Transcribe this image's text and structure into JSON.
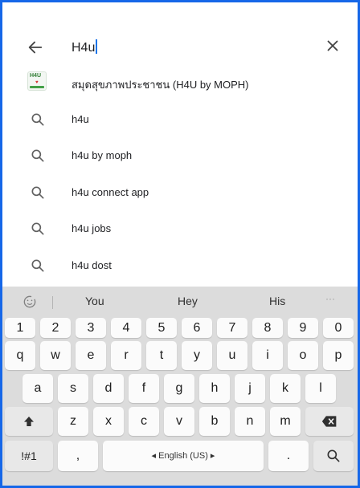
{
  "search": {
    "query": "H4u",
    "back_icon": "arrow-left-icon",
    "clear_icon": "close-icon"
  },
  "suggestions": [
    {
      "type": "app",
      "icon": "h4u-app-icon",
      "label": "สมุดสุขภาพประชาชน (H4U by MOPH)",
      "app_icon_text": "H4U"
    },
    {
      "type": "query",
      "icon": "search-icon",
      "label": "h4u"
    },
    {
      "type": "query",
      "icon": "search-icon",
      "label": "h4u by moph"
    },
    {
      "type": "query",
      "icon": "search-icon",
      "label": "h4u connect app"
    },
    {
      "type": "query",
      "icon": "search-icon",
      "label": "h4u jobs"
    },
    {
      "type": "query",
      "icon": "search-icon",
      "label": "h4u dost"
    }
  ],
  "keyboard": {
    "predictions": [
      "You",
      "Hey",
      "His"
    ],
    "more": "···",
    "row_numbers": [
      "1",
      "2",
      "3",
      "4",
      "5",
      "6",
      "7",
      "8",
      "9",
      "0"
    ],
    "row1": [
      "q",
      "w",
      "e",
      "r",
      "t",
      "y",
      "u",
      "i",
      "o",
      "p"
    ],
    "row2": [
      "a",
      "s",
      "d",
      "f",
      "g",
      "h",
      "j",
      "k",
      "l"
    ],
    "row3": [
      "z",
      "x",
      "c",
      "v",
      "b",
      "n",
      "m"
    ],
    "symbols_label": "!#1",
    "comma": ",",
    "space_label": "◂ English (US) ▸",
    "period": "."
  },
  "colors": {
    "frame_border": "#1667e8",
    "keyboard_bg": "#dcdcdc",
    "key_bg": "#fbfbfb"
  }
}
